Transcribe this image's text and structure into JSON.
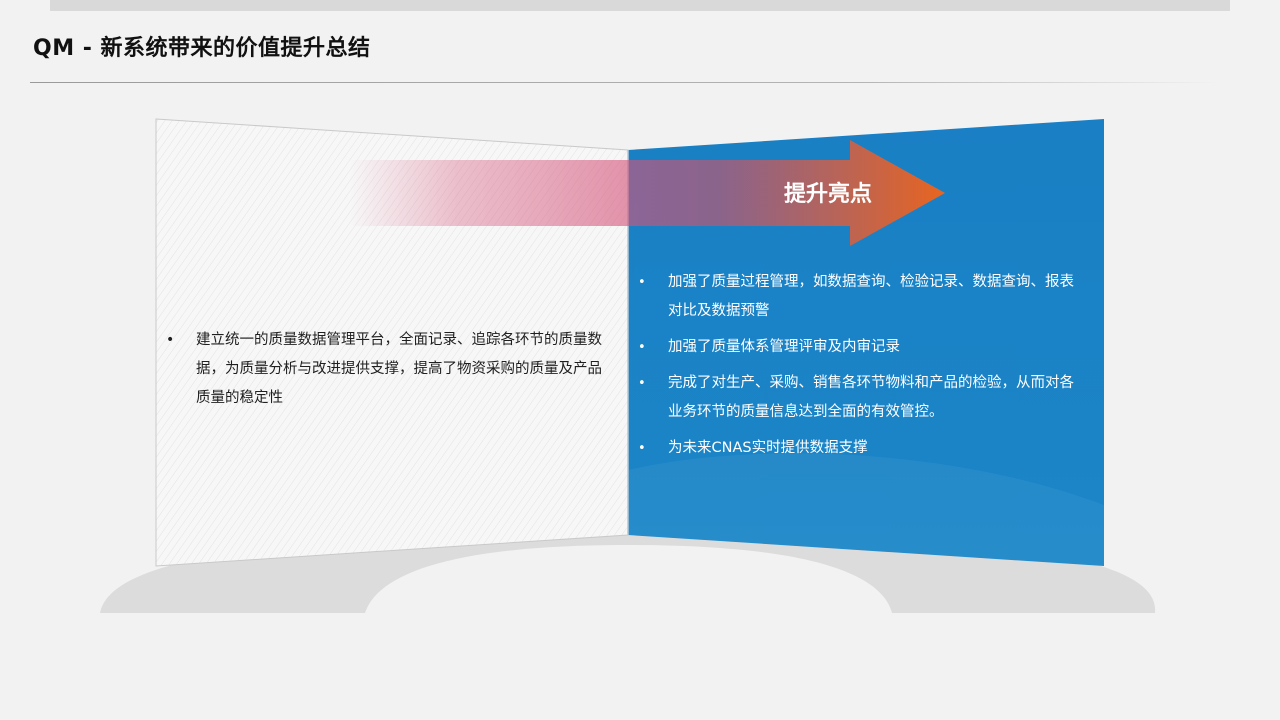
{
  "page": {
    "title": "QM - 新系统带来的价值提升总结"
  },
  "left_panel": {
    "items": [
      "建立统一的质量数据管理平台，全面记录、追踪各环节的质量数据，为质量分析与改进提供支撑，提高了物资采购的质量及产品质量的稳定性"
    ]
  },
  "arrow": {
    "label": "提升亮点"
  },
  "right_panel": {
    "items": [
      "加强了质量过程管理，如数据查询、检验记录、数据查询、报表对比及数据预警",
      "加强了质量体系管理评审及内审记录",
      "完成了对生产、采购、销售各环节物料和产品的检验，从而对各业务环节的质量信息达到全面的有效管控。",
      "为未来CNAS实时提供数据支撑"
    ]
  },
  "colors": {
    "background": "#f2f2f2",
    "blue_panel": "#1c84c6",
    "arrow_start": "#d5547a",
    "arrow_end": "#e8651f",
    "base_arc": "#dcdcdc"
  }
}
